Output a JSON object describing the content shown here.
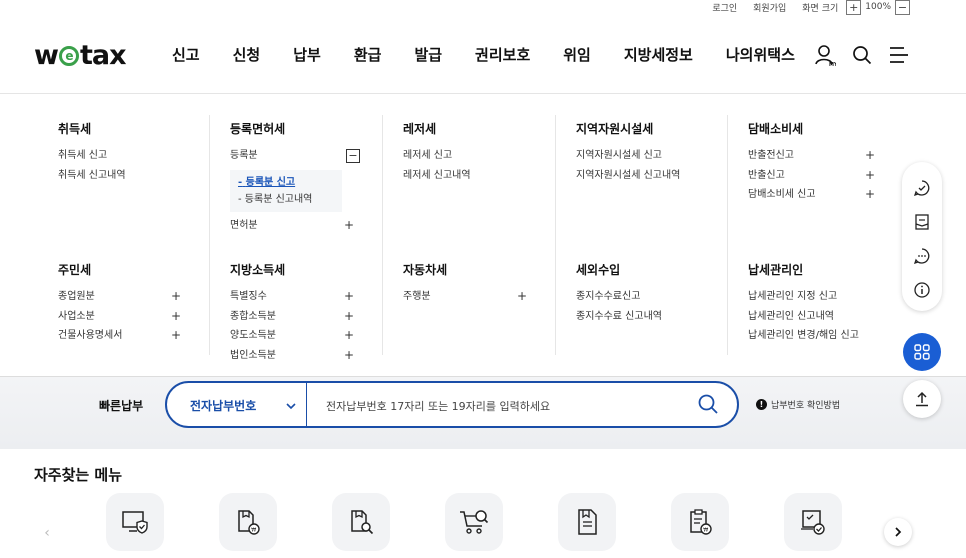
{
  "util": {
    "login": "로그인",
    "signup": "회원가입",
    "zoom_label": "화면 크기",
    "zoom_plus": "+",
    "zoom_value": "100%",
    "zoom_minus": "−"
  },
  "logo": {
    "prefix": "w",
    "e": "e",
    "suffix": "tax"
  },
  "nav": [
    "신고",
    "신청",
    "납부",
    "환급",
    "발급",
    "권리보호",
    "위임",
    "지방세정보",
    "나의위택스"
  ],
  "mega": {
    "col1": {
      "g1": {
        "title": "취득세",
        "items": [
          "취득세 신고",
          "취득세 신고내역"
        ]
      },
      "g2": {
        "title": "주민세",
        "items": [
          "종업원분",
          "사업소분",
          "건물사용명세서"
        ]
      }
    },
    "col2": {
      "g1": {
        "title": "등록면허세",
        "item1": "등록분",
        "minus": "−",
        "sub": [
          "등록분 신고",
          "등록분 신고내역"
        ],
        "sub_prefix": "-",
        "item2": "면허분"
      },
      "g2": {
        "title": "지방소득세",
        "items": [
          "특별징수",
          "종합소득분",
          "양도소득분",
          "법인소득분"
        ]
      }
    },
    "col3": {
      "g1": {
        "title": "레저세",
        "items": [
          "레저세 신고",
          "레저세 신고내역"
        ]
      },
      "g2": {
        "title": "자동차세",
        "items": [
          "주행분"
        ]
      }
    },
    "col4": {
      "g1": {
        "title": "지역자원시설세",
        "items": [
          "지역자원시설세 신고",
          "지역자원시설세 신고내역"
        ]
      },
      "g2": {
        "title": "세외수입",
        "items": [
          "종지수수료신고",
          "종지수수료 신고내역"
        ]
      }
    },
    "col5": {
      "g1": {
        "title": "담배소비세",
        "items": [
          "반출전신고",
          "반출신고",
          "담배소비세 신고"
        ]
      },
      "g2": {
        "title": "납세관리인",
        "items": [
          "납세관리인 지정 신고",
          "납세관리인 신고내역",
          "납세관리인 변경/해임 신고"
        ]
      }
    },
    "plus": "+"
  },
  "quickpay": {
    "label": "빠른납부",
    "select": "전자납부번호",
    "placeholder": "전자납부번호 17자리 또는 19자리를 입력하세요",
    "help_mark": "!",
    "help": "납부번호 확인방법"
  },
  "frequent": {
    "title": "자주찾는 메뉴",
    "prev": "‹"
  },
  "colors": {
    "brand_blue": "#1a4ea8",
    "fab_blue": "#1a5ed4",
    "logo_green": "#3aa04a"
  }
}
